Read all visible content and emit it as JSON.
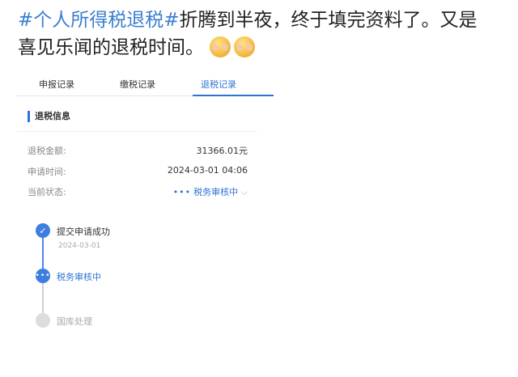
{
  "post": {
    "hashtag": "#个人所得税退税#",
    "text_line1": "折腾到半夜，终于填完资料了。又是",
    "text_line2": "喜见乐闻的退税时间。"
  },
  "tabs": [
    {
      "label": "申报记录"
    },
    {
      "label": "缴税记录"
    },
    {
      "label": "退税记录",
      "active": true
    }
  ],
  "section": {
    "title": "退税信息"
  },
  "fields": [
    {
      "label": "退税金额:",
      "value": "31366.01元"
    },
    {
      "label": "申请时间:",
      "value": "2024-03-01 04:06"
    },
    {
      "label": "当前状态:",
      "value": "税务审核中"
    }
  ],
  "timeline": [
    {
      "label": "提交申请成功",
      "date": "2024-03-01",
      "state": "done"
    },
    {
      "label": "税务审核中",
      "state": "active"
    },
    {
      "label": "国库处理",
      "state": "pending"
    }
  ],
  "colors": {
    "accent": "#2e73d4",
    "hashtag": "#3b7fd0",
    "muted": "#888888"
  }
}
